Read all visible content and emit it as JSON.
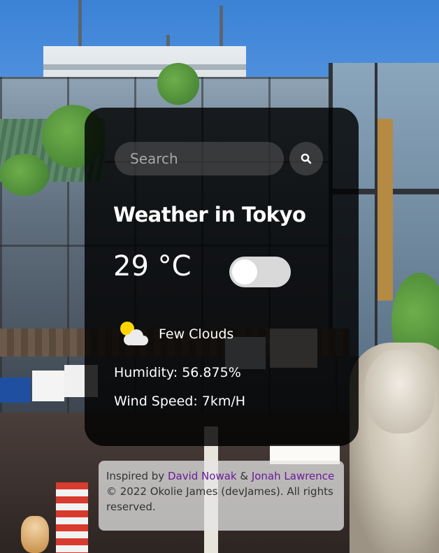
{
  "search": {
    "placeholder": "Search"
  },
  "weather": {
    "title": "Weather in Tokyo",
    "temperature": "29 °C",
    "unit_toggle_state": "off",
    "condition": "Few Clouds",
    "condition_icon": "few-clouds-icon",
    "humidity": "Humidity: 56.875%",
    "wind": "Wind Speed: 7km/H"
  },
  "footer": {
    "inspired_prefix": "Inspired by ",
    "author1": "David Nowak",
    "amp": " & ",
    "author2": "Jonah Lawrence",
    "copyright": "© 2022 Okolie James (devJames). All rights reserved."
  },
  "colors": {
    "card_bg": "#000000",
    "link": "#6a1b9a",
    "toggle_track": "#d9d9d9",
    "sun": "#ffd500"
  }
}
